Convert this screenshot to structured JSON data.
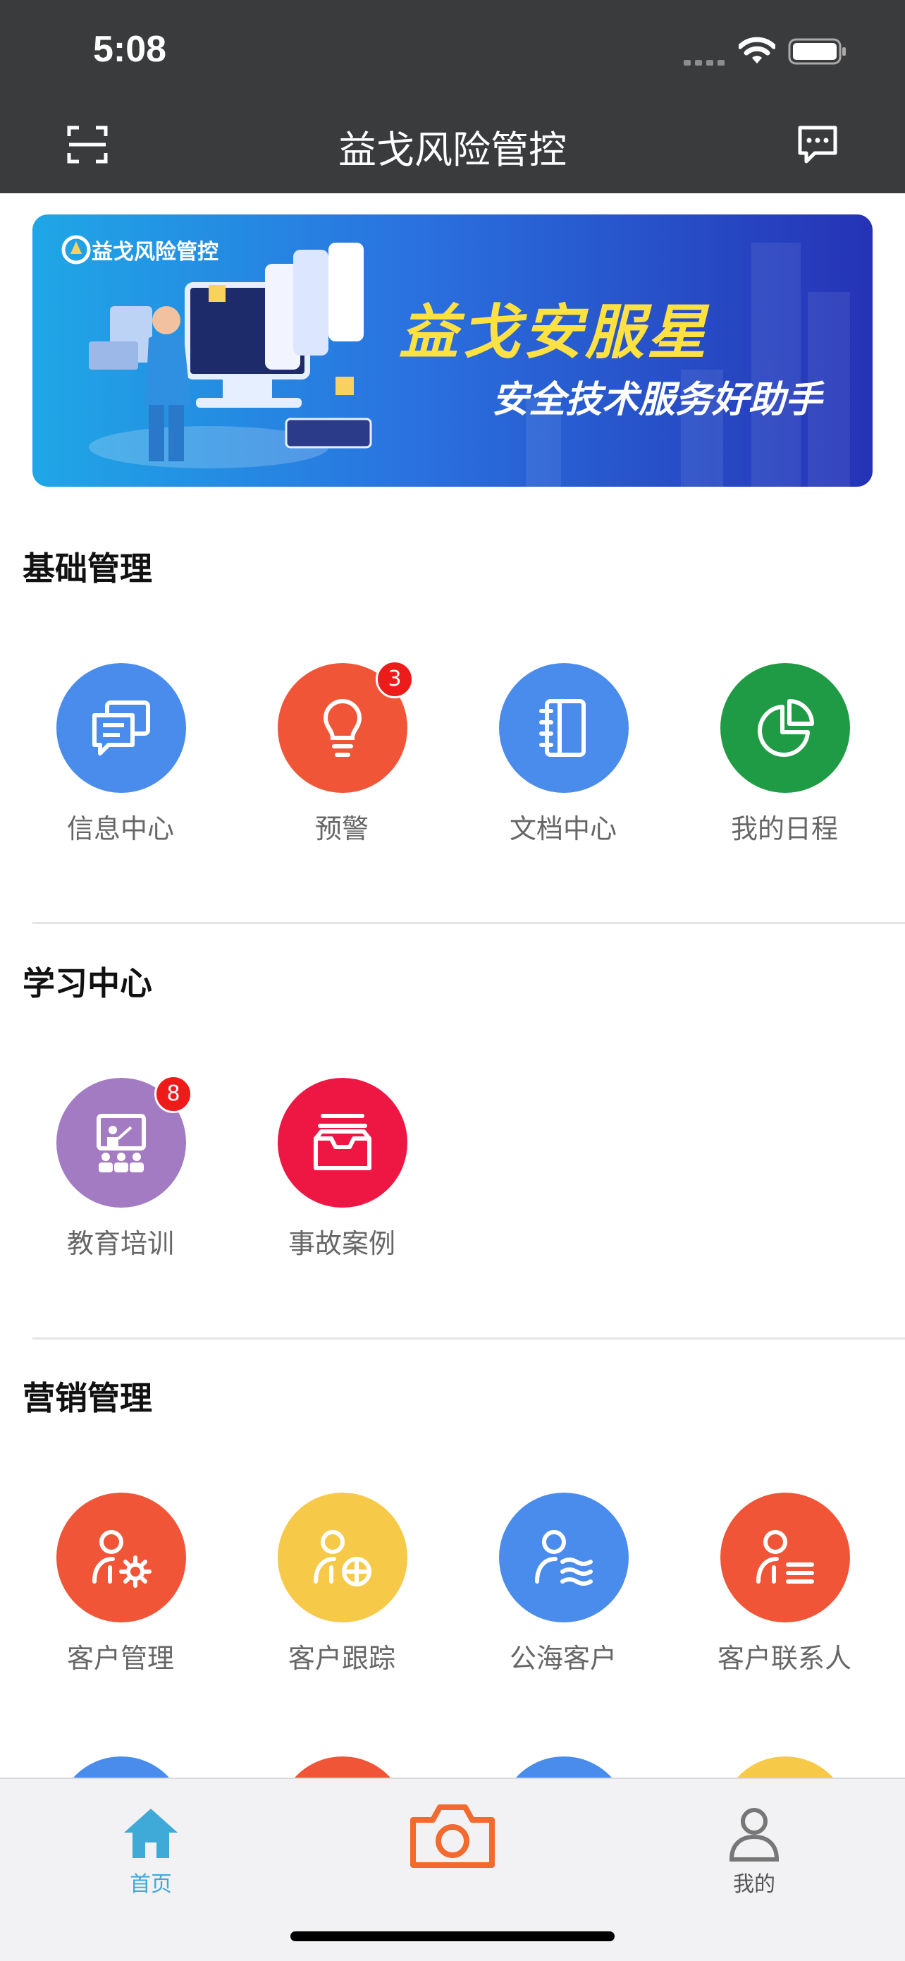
{
  "status": {
    "time": "5:08"
  },
  "nav": {
    "title": "益戈风险管控",
    "left_icon": "scan-icon",
    "right_icon": "message-icon"
  },
  "banner": {
    "logo_text": "益戈风险管控",
    "title": "益戈安服星",
    "subtitle": "安全技术服务好助手"
  },
  "sections": [
    {
      "title": "基础管理",
      "items": [
        {
          "label": "信息中心",
          "icon": "chat-icon",
          "color": "#4a8cec"
        },
        {
          "label": "预警",
          "icon": "lightbulb-icon",
          "color": "#f05537",
          "badge": "3"
        },
        {
          "label": "文档中心",
          "icon": "notebook-icon",
          "color": "#4a8cec"
        },
        {
          "label": "我的日程",
          "icon": "pie-chart-icon",
          "color": "#1f9b45"
        }
      ]
    },
    {
      "title": "学习中心",
      "items": [
        {
          "label": "教育培训",
          "icon": "classroom-icon",
          "color": "#a37bc2",
          "badge": "8"
        },
        {
          "label": "事故案例",
          "icon": "inbox-icon",
          "color": "#ee1744"
        }
      ]
    },
    {
      "title": "营销管理",
      "items": [
        {
          "label": "客户管理",
          "icon": "user-gear-icon",
          "color": "#f05537"
        },
        {
          "label": "客户跟踪",
          "icon": "user-target-icon",
          "color": "#f7c948"
        },
        {
          "label": "公海客户",
          "icon": "user-sea-icon",
          "color": "#4a8cec"
        },
        {
          "label": "客户联系人",
          "icon": "user-list-icon",
          "color": "#f05537"
        }
      ]
    }
  ],
  "tabbar": [
    {
      "label": "首页",
      "icon": "home-icon",
      "active": true
    },
    {
      "label": "",
      "icon": "camera-icon"
    },
    {
      "label": "我的",
      "icon": "person-icon"
    }
  ],
  "colors": {
    "accent": "#3fa9d8",
    "camera": "#f26a2e",
    "header": "#3a3b3d"
  }
}
